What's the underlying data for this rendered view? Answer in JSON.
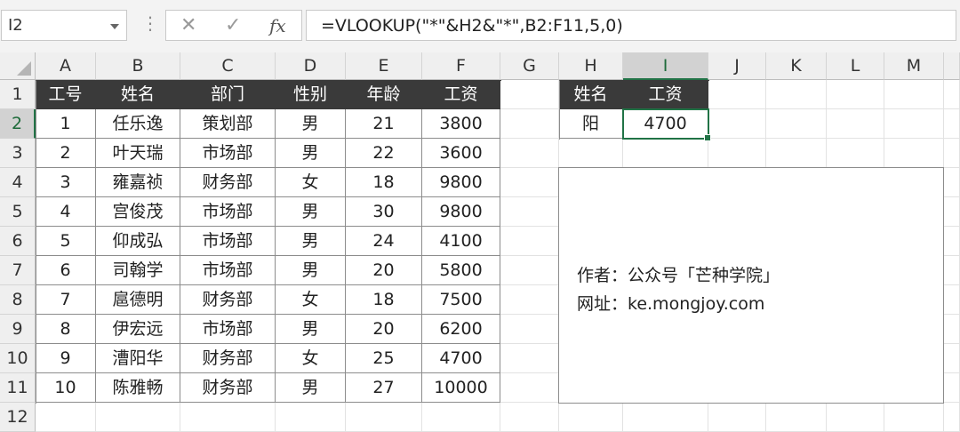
{
  "formula_bar": {
    "name_box": "I2",
    "menu_dots": "⋮",
    "cancel_glyph": "✕",
    "enter_glyph": "✓",
    "fx_glyph": "fx",
    "formula": "=VLOOKUP(\"*\"&H2&\"*\",B2:F11,5,0)"
  },
  "columns": [
    "A",
    "B",
    "C",
    "D",
    "E",
    "F",
    "G",
    "H",
    "I",
    "J",
    "K",
    "L",
    "M"
  ],
  "rows": [
    "1",
    "2",
    "3",
    "4",
    "5",
    "6",
    "7",
    "8",
    "9",
    "10",
    "11",
    "12"
  ],
  "active_cell": "I2",
  "table": {
    "headers": [
      "工号",
      "姓名",
      "部门",
      "性别",
      "年龄",
      "工资"
    ],
    "rows": [
      [
        "1",
        "任乐逸",
        "策划部",
        "男",
        "21",
        "3800"
      ],
      [
        "2",
        "叶天瑞",
        "市场部",
        "男",
        "22",
        "3600"
      ],
      [
        "3",
        "雍嘉祯",
        "财务部",
        "女",
        "18",
        "9800"
      ],
      [
        "4",
        "宫俊茂",
        "市场部",
        "男",
        "30",
        "9800"
      ],
      [
        "5",
        "仰成弘",
        "市场部",
        "男",
        "24",
        "4100"
      ],
      [
        "6",
        "司翰学",
        "市场部",
        "男",
        "20",
        "5800"
      ],
      [
        "7",
        "扈德明",
        "财务部",
        "女",
        "18",
        "7500"
      ],
      [
        "8",
        "伊宏远",
        "市场部",
        "男",
        "20",
        "6200"
      ],
      [
        "9",
        "漕阳华",
        "财务部",
        "女",
        "25",
        "4700"
      ],
      [
        "10",
        "陈雅畅",
        "财务部",
        "男",
        "27",
        "10000"
      ]
    ]
  },
  "lookup": {
    "headers": [
      "姓名",
      "工资"
    ],
    "values": [
      "阳",
      "4700"
    ]
  },
  "note": {
    "author": "作者：公众号「芒种学院」",
    "site": "网址：ke.mongjoy.com"
  },
  "colors": {
    "header_fill": "#3a3a3a",
    "selection_green": "#217346"
  }
}
